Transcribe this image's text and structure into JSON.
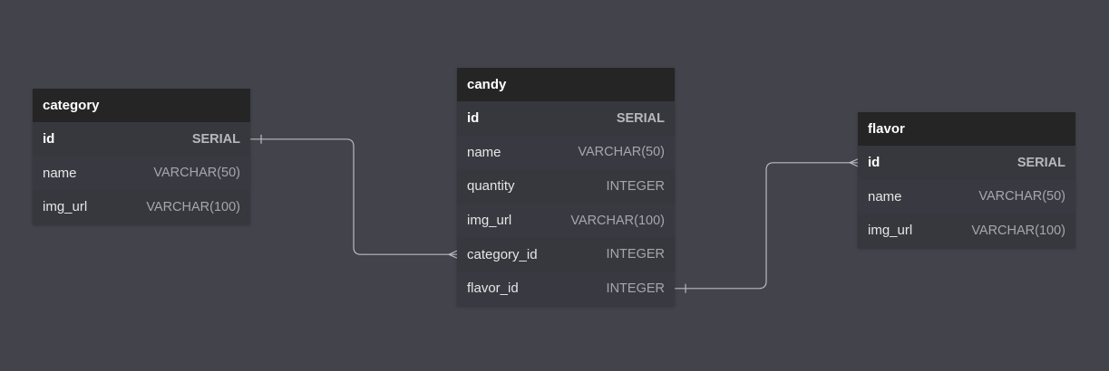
{
  "tables": [
    {
      "id": "category",
      "name": "category",
      "fields": [
        {
          "name": "id",
          "type": "SERIAL",
          "pk": true
        },
        {
          "name": "name",
          "type": "VARCHAR(50)",
          "pk": false
        },
        {
          "name": "img_url",
          "type": "VARCHAR(100)",
          "pk": false
        }
      ]
    },
    {
      "id": "candy",
      "name": "candy",
      "fields": [
        {
          "name": "id",
          "type": "SERIAL",
          "pk": true
        },
        {
          "name": "name",
          "type": "VARCHAR(50)",
          "pk": false
        },
        {
          "name": "quantity",
          "type": "INTEGER",
          "pk": false
        },
        {
          "name": "img_url",
          "type": "VARCHAR(100)",
          "pk": false
        },
        {
          "name": "category_id",
          "type": "INTEGER",
          "pk": false
        },
        {
          "name": "flavor_id",
          "type": "INTEGER",
          "pk": false
        }
      ]
    },
    {
      "id": "flavor",
      "name": "flavor",
      "fields": [
        {
          "name": "id",
          "type": "SERIAL",
          "pk": true
        },
        {
          "name": "name",
          "type": "VARCHAR(50)",
          "pk": false
        },
        {
          "name": "img_url",
          "type": "VARCHAR(100)",
          "pk": false
        }
      ]
    }
  ],
  "relations": [
    {
      "from_table": "category",
      "from_field": "id",
      "from_card": "one",
      "to_table": "candy",
      "to_field": "category_id",
      "to_card": "many"
    },
    {
      "from_table": "candy",
      "from_field": "flavor_id",
      "from_card": "one",
      "to_table": "flavor",
      "to_field": "id",
      "to_card": "many"
    }
  ]
}
